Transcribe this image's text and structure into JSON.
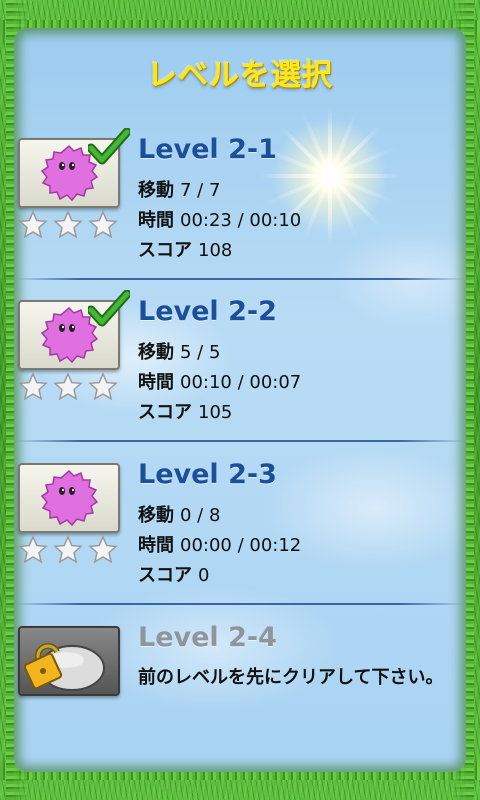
{
  "screen": {
    "title": "レベルを選択"
  },
  "labels": {
    "moves": "移動",
    "time": "時間",
    "score": "スコア"
  },
  "levels": [
    {
      "name": "Level 2-1",
      "moves": "7 / 7",
      "time": "00:23 / 00:10",
      "score": "108",
      "completed": true,
      "locked": false,
      "stars_earned": 0
    },
    {
      "name": "Level 2-2",
      "moves": "5 / 5",
      "time": "00:10 / 00:07",
      "score": "105",
      "completed": true,
      "locked": false,
      "stars_earned": 0
    },
    {
      "name": "Level 2-3",
      "moves": "0 / 8",
      "time": "00:00 / 00:12",
      "score": "0",
      "completed": false,
      "locked": false,
      "stars_earned": 0
    },
    {
      "name": "Level 2-4",
      "locked": true,
      "locked_message": "前のレベルを先にクリアして下さい。"
    }
  ],
  "colors": {
    "title": "#ffe818",
    "level_name": "#1c4f9a",
    "level_name_locked": "#8f959c",
    "blob": "#e070e0",
    "check": "#3aa02a"
  },
  "icons": {
    "monster": "pink-blob-icon",
    "completed": "checkmark-icon",
    "star": "star-icon",
    "locked": "padlock-icon"
  }
}
